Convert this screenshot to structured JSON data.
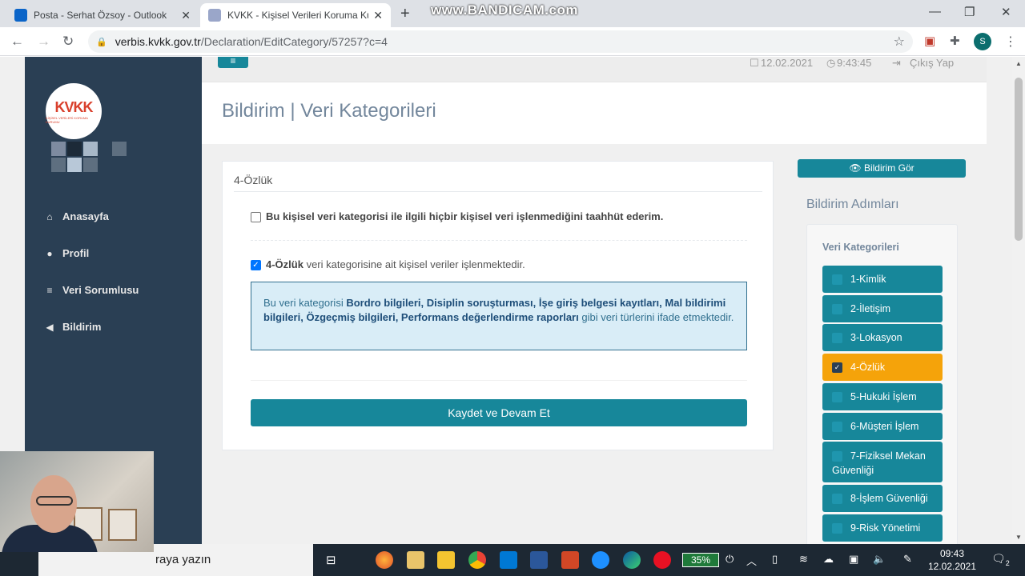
{
  "browser": {
    "tabs": [
      {
        "title": "Posta - Serhat Özsoy - Outlook",
        "active": false,
        "favicon_color": "#0a64c8"
      },
      {
        "title": "KVKK - Kişisel Verileri Koruma Ku",
        "active": true,
        "favicon_color": "#9aa6c9"
      }
    ],
    "watermark": "www.BANDICAM.com",
    "url_host": "verbis.kvkk.gov.tr",
    "url_path": "/Declaration/EditCategory/57257?c=4",
    "profile_initial": "S"
  },
  "topbar": {
    "date": "12.02.2021",
    "time": "9:43:45",
    "logout": "Çıkış Yap"
  },
  "sidebar": {
    "logo_text": "KVKK",
    "logo_subtext": "KİŞİSEL VERİLERİ KORUMA KURUMU",
    "items": [
      {
        "label": "Anasayfa",
        "icon": "home-icon"
      },
      {
        "label": "Profil",
        "icon": "user-icon"
      },
      {
        "label": "Veri Sorumlusu",
        "icon": "database-icon"
      },
      {
        "label": "Bildirim",
        "icon": "bullhorn-icon"
      }
    ]
  },
  "page": {
    "title": "Bildirim | Veri Kategorileri"
  },
  "form": {
    "section_title": "4-Özlük",
    "declare_none_label": "Bu kişisel veri kategorisi ile ilgili hiçbir kişisel veri işlenmediğini taahhüt ederim.",
    "declare_none_checked": false,
    "category_checked": true,
    "category_name": "4-Özlük",
    "category_suffix": " veri kategorisine ait kişisel veriler işlenmektedir.",
    "info_prefix": "Bu veri kategorisi ",
    "info_types": "Bordro bilgileri, Disiplin soruşturması, İşe giriş belgesi kayıtları, Mal bildirimi bilgileri, Özgeçmiş bilgileri, Performans değerlendirme raporları",
    "info_suffix": " gibi veri türlerini ifade etmektedir.",
    "submit_label": "Kaydet ve Devam Et"
  },
  "steps": {
    "view_button": "Bildirim Gör",
    "title": "Bildirim Adımları",
    "subtitle": "Veri Kategorileri",
    "items": [
      {
        "label": "1-Kimlik"
      },
      {
        "label": "2-İletişim"
      },
      {
        "label": "3-Lokasyon"
      },
      {
        "label": "4-Özlük",
        "active": true
      },
      {
        "label": "5-Hukuki İşlem"
      },
      {
        "label": "6-Müşteri İşlem"
      },
      {
        "label": "7-Fiziksel Mekan Güvenliği"
      },
      {
        "label": "8-İşlem Güvenliği"
      },
      {
        "label": "9-Risk Yönetimi"
      }
    ]
  },
  "taskbar": {
    "search_text": "raya yazın",
    "battery": "35%",
    "time": "09:43",
    "date": "12.02.2021",
    "notifications": "2"
  }
}
